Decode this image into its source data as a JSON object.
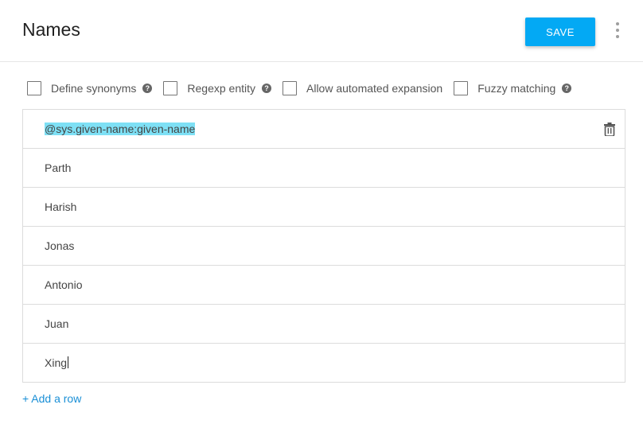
{
  "header": {
    "title": "Names",
    "save_label": "SAVE"
  },
  "options": [
    {
      "label": "Define synonyms",
      "help": true,
      "checked": false
    },
    {
      "label": "Regexp entity",
      "help": true,
      "checked": false
    },
    {
      "label": "Allow automated expansion",
      "help": false,
      "checked": false
    },
    {
      "label": "Fuzzy matching",
      "help": true,
      "checked": false
    }
  ],
  "rows": [
    "@sys.given-name:given-name",
    "Parth",
    "Harish",
    "Jonas",
    "Antonio",
    "Juan",
    "Xing"
  ],
  "add_row_label": "+ Add a row",
  "colors": {
    "accent": "#03a9f4",
    "link": "#1a8fd6",
    "highlight": "#7ee0f5"
  }
}
